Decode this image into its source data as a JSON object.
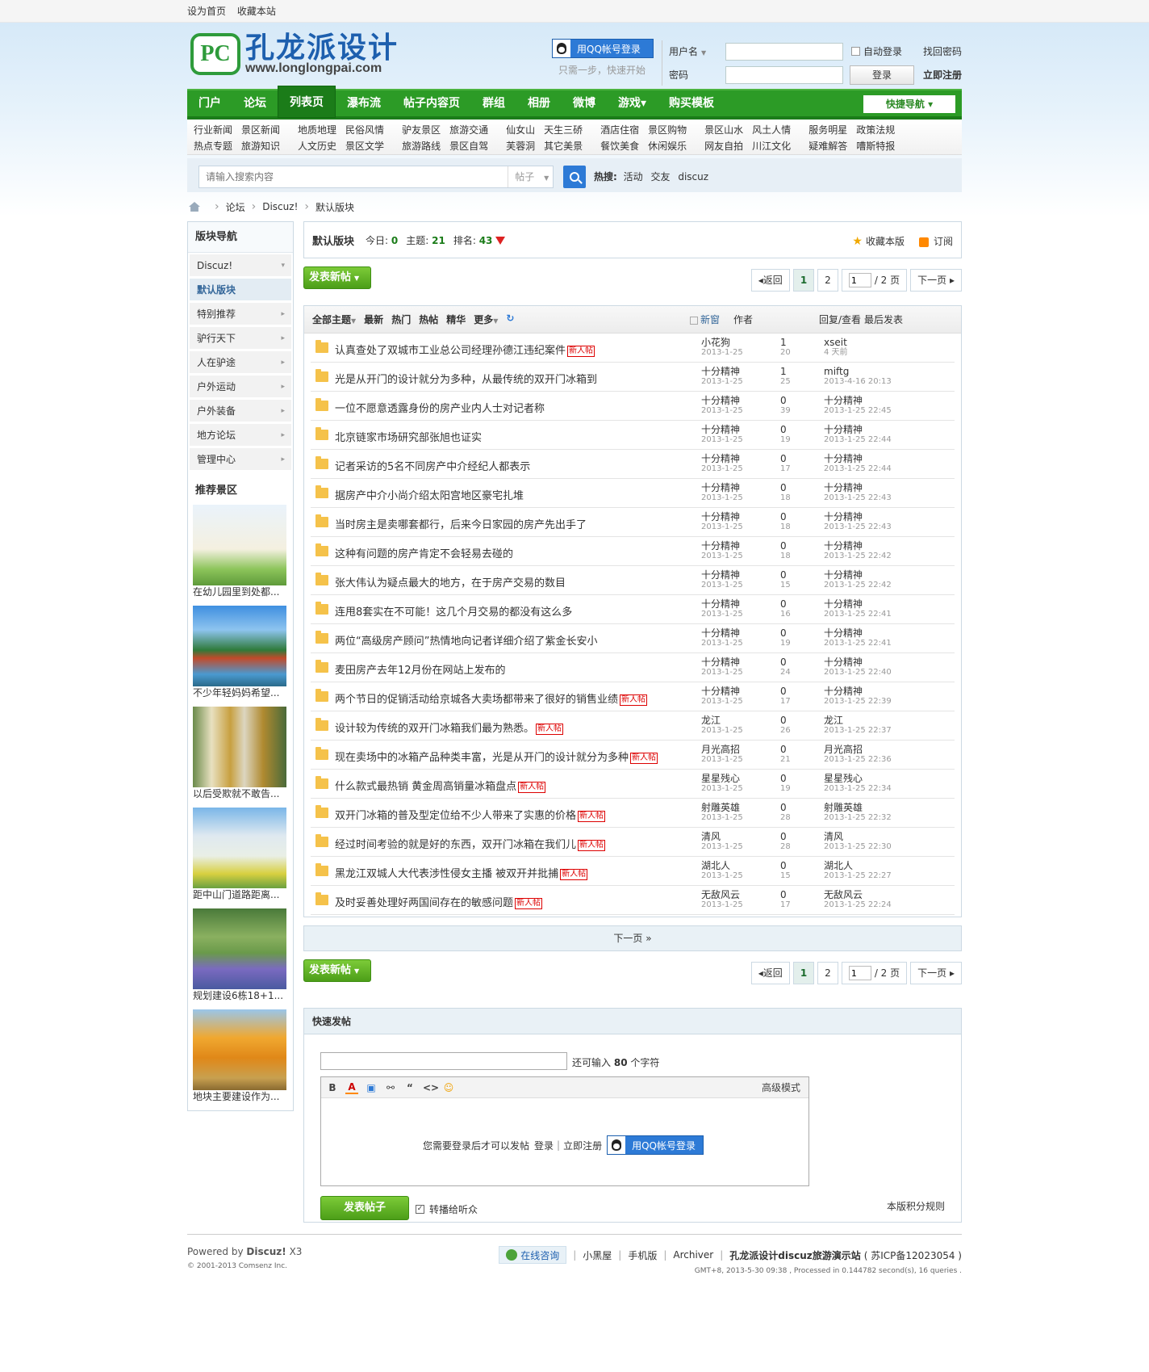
{
  "topbar": {
    "set_home": "设为首页",
    "bookmark": "收藏本站"
  },
  "logo": {
    "name": "孔龙派设计",
    "url": "www.longlongpai.com",
    "mark": "PC"
  },
  "qq": {
    "button": "用QQ帐号登录",
    "sub": "只需一步，快速开始"
  },
  "login": {
    "username_label": "用户名",
    "password_label": "密码",
    "auto_login": "自动登录",
    "find_password": "找回密码",
    "login_button": "登录",
    "register": "立即注册"
  },
  "nav": {
    "items": [
      "门户",
      "论坛",
      "列表页",
      "瀑布流",
      "帖子内容页",
      "群组",
      "相册",
      "微博",
      "游戏▾",
      "购买模板"
    ],
    "current": "列表页",
    "quick_nav": "快捷导航 ▾"
  },
  "subnav": [
    [
      "行业新闻",
      "景区新闻",
      "热点专题",
      "旅游知识"
    ],
    [
      "地质地理",
      "民俗风情",
      "人文历史",
      "景区文学"
    ],
    [
      "驴友景区",
      "旅游交通",
      "旅游路线",
      "景区自驾"
    ],
    [
      "仙女山",
      "天生三硚",
      "芙蓉洞",
      "其它美景"
    ],
    [
      "酒店住宿",
      "景区购物",
      "餐饮美食",
      "休闲娱乐"
    ],
    [
      "景区山水",
      "风土人情",
      "网友自拍",
      "川江文化"
    ],
    [
      "服务明星",
      "政策法规",
      "疑难解答",
      "嘈斯特报"
    ]
  ],
  "search": {
    "placeholder": "请输入搜索内容",
    "type": "帖子",
    "hot_label": "热搜:",
    "hot": [
      "活动",
      "交友",
      "discuz"
    ]
  },
  "breadcrumb": [
    "论坛",
    "Discuz!",
    "默认版块"
  ],
  "sidebar": {
    "title": "版块导航",
    "items": [
      {
        "label": "Discuz!",
        "arrow": "▾"
      },
      {
        "label": "默认版块",
        "arrow": ""
      },
      {
        "label": "特别推荐",
        "arrow": "▸"
      },
      {
        "label": "驴行天下",
        "arrow": "▸"
      },
      {
        "label": "人在驴途",
        "arrow": "▸"
      },
      {
        "label": "户外运动",
        "arrow": "▸"
      },
      {
        "label": "户外装备",
        "arrow": "▸"
      },
      {
        "label": "地方论坛",
        "arrow": "▸"
      },
      {
        "label": "管理中心",
        "arrow": "▸"
      }
    ],
    "rec_title": "推荐景区",
    "pics": [
      "在幼儿园里到处都...",
      "不少年轻妈妈希望...",
      "以后受欺就不敢告...",
      "距中山门道路距离...",
      "规划建设6栋18+1...",
      "地块主要建设作为..."
    ]
  },
  "forum": {
    "name": "默认版块",
    "today_label": "今日:",
    "today": "0",
    "topics_label": "主题:",
    "topics": "21",
    "rank_label": "排名:",
    "rank": "43",
    "fav": "收藏本版",
    "rss": "订阅"
  },
  "pager": {
    "new_post": "发表新帖",
    "back": "返回",
    "pages": [
      "1",
      "2"
    ],
    "current": "1",
    "input": "1",
    "total": "/ 2 页",
    "next": "下一页"
  },
  "thread_header": {
    "tabs": [
      "全部主题",
      "最新",
      "热门",
      "热帖",
      "精华",
      "更多"
    ],
    "new_window": "新窗",
    "author": "作者",
    "replies": "回复/查看",
    "lastpost": "最后发表"
  },
  "threads": [
    {
      "title": "认真查处了双城市工业总公司经理孙德江违纪案件",
      "new": true,
      "author": "小花狗",
      "date": "2013-1-25",
      "replies": "1",
      "views": "20",
      "last_user": "xseit",
      "last_time": "4 天前"
    },
    {
      "title": "光是从开门的设计就分为多种，从最传统的双开门冰箱到",
      "new": false,
      "author": "十分精神",
      "date": "2013-1-25",
      "replies": "1",
      "views": "25",
      "last_user": "miftg",
      "last_time": "2013-4-16 20:13"
    },
    {
      "title": "一位不愿意透露身份的房产业内人士对记者称",
      "new": false,
      "author": "十分精神",
      "date": "2013-1-25",
      "replies": "0",
      "views": "39",
      "last_user": "十分精神",
      "last_time": "2013-1-25 22:45"
    },
    {
      "title": "北京链家市场研究部张旭也证实",
      "new": false,
      "author": "十分精神",
      "date": "2013-1-25",
      "replies": "0",
      "views": "19",
      "last_user": "十分精神",
      "last_time": "2013-1-25 22:44"
    },
    {
      "title": "记者采访的5名不同房产中介经纪人都表示",
      "new": false,
      "author": "十分精神",
      "date": "2013-1-25",
      "replies": "0",
      "views": "17",
      "last_user": "十分精神",
      "last_time": "2013-1-25 22:44"
    },
    {
      "title": "据房产中介小尚介绍太阳宫地区豪宅扎堆",
      "new": false,
      "author": "十分精神",
      "date": "2013-1-25",
      "replies": "0",
      "views": "18",
      "last_user": "十分精神",
      "last_time": "2013-1-25 22:43"
    },
    {
      "title": "当时房主是卖哪套都行，后来今日家园的房产先出手了",
      "new": false,
      "author": "十分精神",
      "date": "2013-1-25",
      "replies": "0",
      "views": "18",
      "last_user": "十分精神",
      "last_time": "2013-1-25 22:43"
    },
    {
      "title": "这种有问题的房产肯定不会轻易去碰的",
      "new": false,
      "author": "十分精神",
      "date": "2013-1-25",
      "replies": "0",
      "views": "18",
      "last_user": "十分精神",
      "last_time": "2013-1-25 22:42"
    },
    {
      "title": "张大伟认为疑点最大的地方，在于房产交易的数目",
      "new": false,
      "author": "十分精神",
      "date": "2013-1-25",
      "replies": "0",
      "views": "15",
      "last_user": "十分精神",
      "last_time": "2013-1-25 22:42"
    },
    {
      "title": "连甩8套实在不可能！这几个月交易的都没有这么多",
      "new": false,
      "author": "十分精神",
      "date": "2013-1-25",
      "replies": "0",
      "views": "16",
      "last_user": "十分精神",
      "last_time": "2013-1-25 22:41"
    },
    {
      "title": "两位“高级房产顾问”热情地向记者详细介绍了紫金长安小",
      "new": false,
      "author": "十分精神",
      "date": "2013-1-25",
      "replies": "0",
      "views": "19",
      "last_user": "十分精神",
      "last_time": "2013-1-25 22:41"
    },
    {
      "title": "麦田房产去年12月份在网站上发布的",
      "new": false,
      "author": "十分精神",
      "date": "2013-1-25",
      "replies": "0",
      "views": "24",
      "last_user": "十分精神",
      "last_time": "2013-1-25 22:40"
    },
    {
      "title": "两个节日的促销活动给京城各大卖场都带来了很好的销售业绩",
      "new": true,
      "author": "十分精神",
      "date": "2013-1-25",
      "replies": "0",
      "views": "17",
      "last_user": "十分精神",
      "last_time": "2013-1-25 22:39"
    },
    {
      "title": "设计较为传统的双开门冰箱我们最为熟悉。",
      "new": true,
      "author": "龙江",
      "date": "2013-1-25",
      "replies": "0",
      "views": "26",
      "last_user": "龙江",
      "last_time": "2013-1-25 22:37"
    },
    {
      "title": "现在卖场中的冰箱产品种类丰富，光是从开门的设计就分为多种",
      "new": true,
      "author": "月光高招",
      "date": "2013-1-25",
      "replies": "0",
      "views": "21",
      "last_user": "月光高招",
      "last_time": "2013-1-25 22:36"
    },
    {
      "title": "什么款式最热销 黄金周高销量冰箱盘点",
      "new": true,
      "author": "星星残心",
      "date": "2013-1-25",
      "replies": "0",
      "views": "19",
      "last_user": "星星残心",
      "last_time": "2013-1-25 22:34"
    },
    {
      "title": "双开门冰箱的普及型定位给不少人带来了实惠的价格",
      "new": true,
      "author": "射雕英雄",
      "date": "2013-1-25",
      "replies": "0",
      "views": "28",
      "last_user": "射雕英雄",
      "last_time": "2013-1-25 22:32"
    },
    {
      "title": "经过时间考验的就是好的东西，双开门冰箱在我们儿",
      "new": true,
      "author": "清风",
      "date": "2013-1-25",
      "replies": "0",
      "views": "28",
      "last_user": "清风",
      "last_time": "2013-1-25 22:30"
    },
    {
      "title": "黑龙江双城人大代表涉性侵女主播 被双开并批捕",
      "new": true,
      "author": "湖北人",
      "date": "2013-1-25",
      "replies": "0",
      "views": "15",
      "last_user": "湖北人",
      "last_time": "2013-1-25 22:27"
    },
    {
      "title": "及时妥善处理好两国间存在的敏感问题",
      "new": true,
      "author": "无敌风云",
      "date": "2013-1-25",
      "replies": "0",
      "views": "17",
      "last_user": "无敌风云",
      "last_time": "2013-1-25 22:24"
    }
  ],
  "new_tag": "新人帖",
  "more_link": "下一页 »",
  "quickpost": {
    "title": "快速发帖",
    "remaining_prefix": "还可输入",
    "remaining": "80",
    "remaining_suffix": "个字符",
    "advanced": "高级模式",
    "need_login": "您需要登录后才可以发帖",
    "login": "登录",
    "register": "立即注册",
    "post": "发表帖子",
    "sync": "转播给听众",
    "rules": "本版积分规则",
    "toolbar": [
      "B",
      "A",
      "▣",
      "⚯",
      "“",
      "<>",
      "☺"
    ]
  },
  "footer": {
    "powered_prefix": "Powered by",
    "powered_brand": "Discuz!",
    "powered_ver": "X3",
    "copyright": "© 2001-2013 Comsenz Inc.",
    "online": "在线咨询",
    "links": [
      "小黑屋",
      "手机版",
      "Archiver"
    ],
    "site": "孔龙派设计discuz旅游演示站",
    "icp": "( 苏ICP备12023054 )",
    "gmt": "GMT+8, 2013-5-30 09:38 , Processed in 0.144782 second(s), 16 queries ."
  },
  "colors": {
    "nav": "#2c9b26",
    "accent": "#2d7ad6",
    "new_tag": "#dd0000"
  }
}
